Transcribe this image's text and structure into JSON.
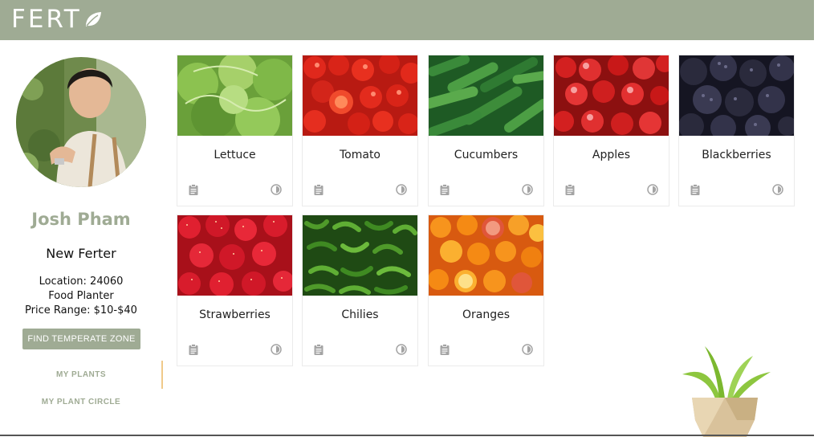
{
  "app": {
    "logo_text": "FERT",
    "brand_color": "#9fab94",
    "accent_color": "#f0c98a"
  },
  "profile": {
    "name": "Josh Pham",
    "role": "New Ferter",
    "location": "Location: 24060",
    "occupation": "Food Planter",
    "price_range": "Price Range: $10-$40",
    "find_zone_button": "FIND TEMPERATE ZONE"
  },
  "nav": {
    "items": [
      {
        "label": "MY PLANTS",
        "active": true
      },
      {
        "label": "MY PLANT CIRCLE",
        "active": false
      }
    ]
  },
  "plants": [
    {
      "name": "Lettuce",
      "left_icon": "clipboard-icon",
      "right_icon": "timer-icon"
    },
    {
      "name": "Tomato",
      "left_icon": "clipboard-icon",
      "right_icon": "timer-icon"
    },
    {
      "name": "Cucumbers",
      "left_icon": "clipboard-icon",
      "right_icon": "timer-icon"
    },
    {
      "name": "Apples",
      "left_icon": "clipboard-icon",
      "right_icon": "timer-icon"
    },
    {
      "name": "Blackberries",
      "left_icon": "clipboard-icon",
      "right_icon": "timer-icon"
    },
    {
      "name": "Strawberries",
      "left_icon": "clipboard-icon",
      "right_icon": "timer-icon"
    },
    {
      "name": "Chilies",
      "left_icon": "clipboard-icon",
      "right_icon": "timer-icon"
    },
    {
      "name": "Oranges",
      "left_icon": "clipboard-icon",
      "right_icon": "timer-icon"
    }
  ]
}
